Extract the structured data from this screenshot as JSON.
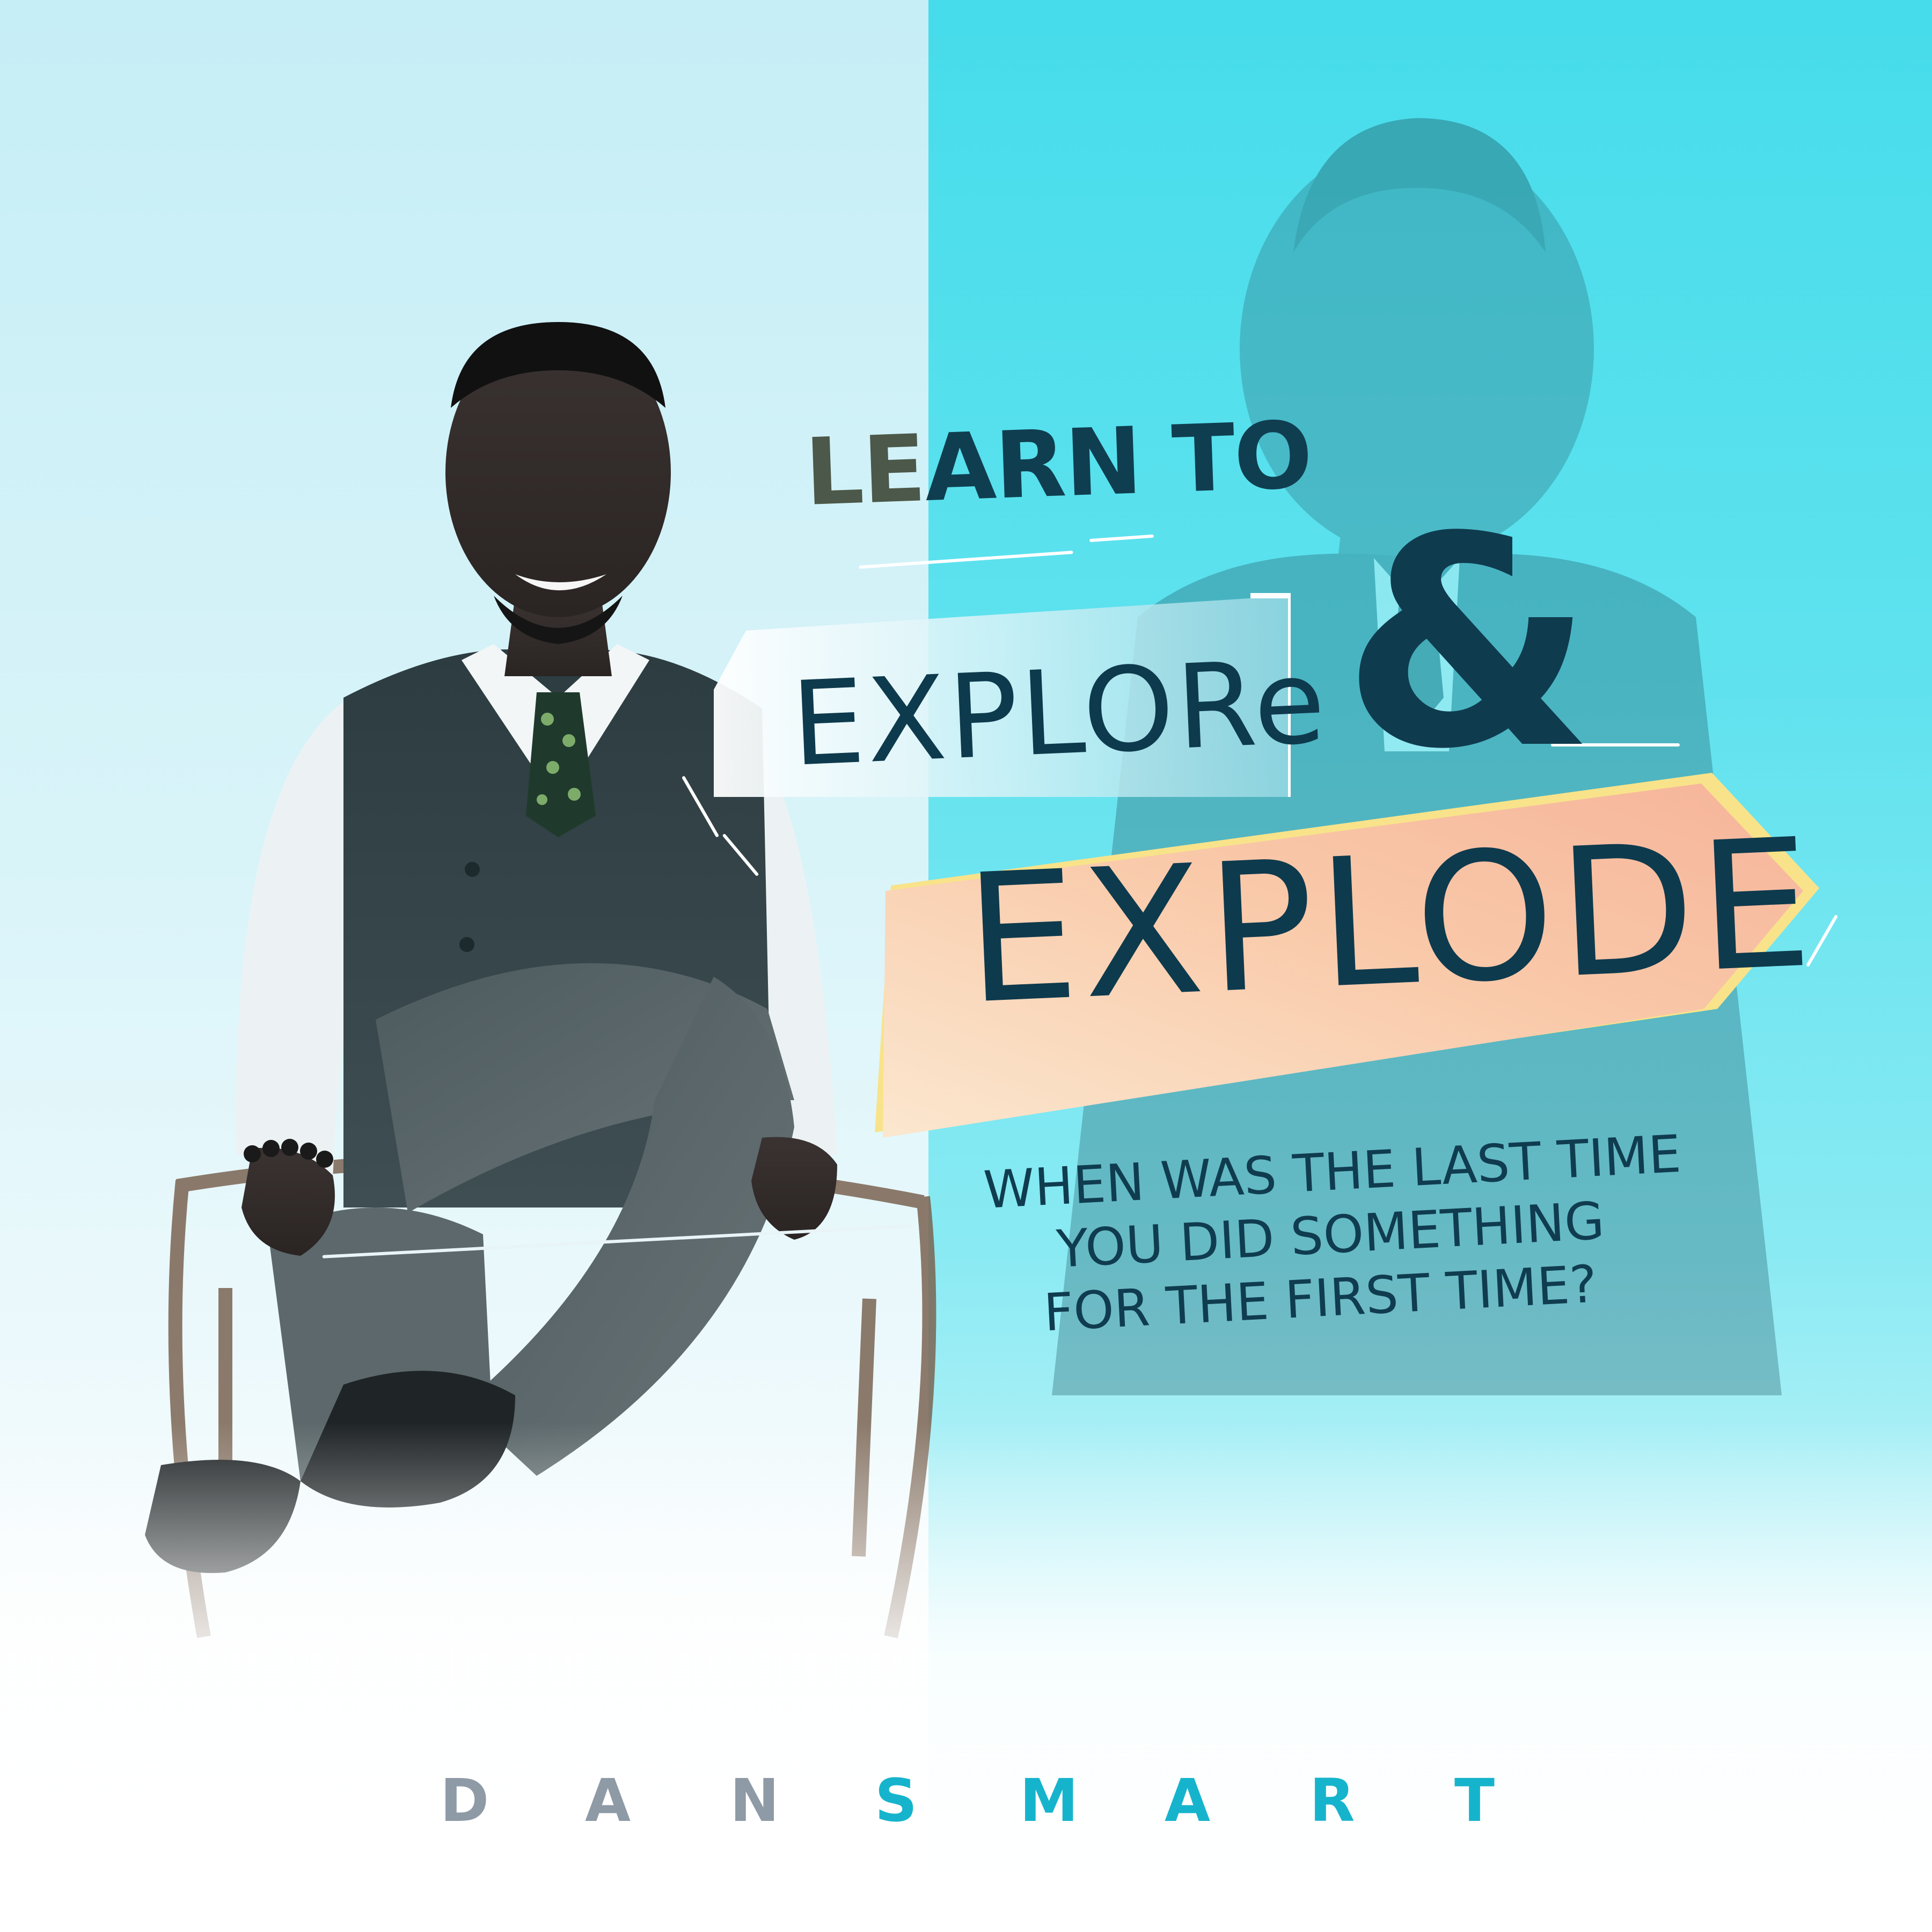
{
  "headline": {
    "lead_letters": "LE",
    "rest": "ARN TO",
    "explore": "EXPLORe",
    "ampersand": "&",
    "explode": "EXPLODE"
  },
  "question": {
    "line1": "WHEN WAS THE LAST TIME",
    "line2": "YOU DID SOMETHING",
    "line3": "FOR THE FIRST TIME?"
  },
  "brand": {
    "letters": [
      "D",
      "A",
      "N",
      "S",
      "M",
      "A",
      "R",
      "T"
    ],
    "colors": [
      "#8e9aa6",
      "#8e9aa6",
      "#8e9aa6",
      "#16b4cc",
      "#16b4cc",
      "#16b4cc",
      "#16b4cc",
      "#16b4cc"
    ]
  },
  "colors": {
    "text_dark": "#0f3e50",
    "lead_dark": "#4c5849",
    "panel_cyan": "#46dceb",
    "banner_peach": "#f9c6a4",
    "banner_yellow": "#f8e38a",
    "brand_gray": "#8e9aa6",
    "brand_cyan": "#16b4cc"
  }
}
